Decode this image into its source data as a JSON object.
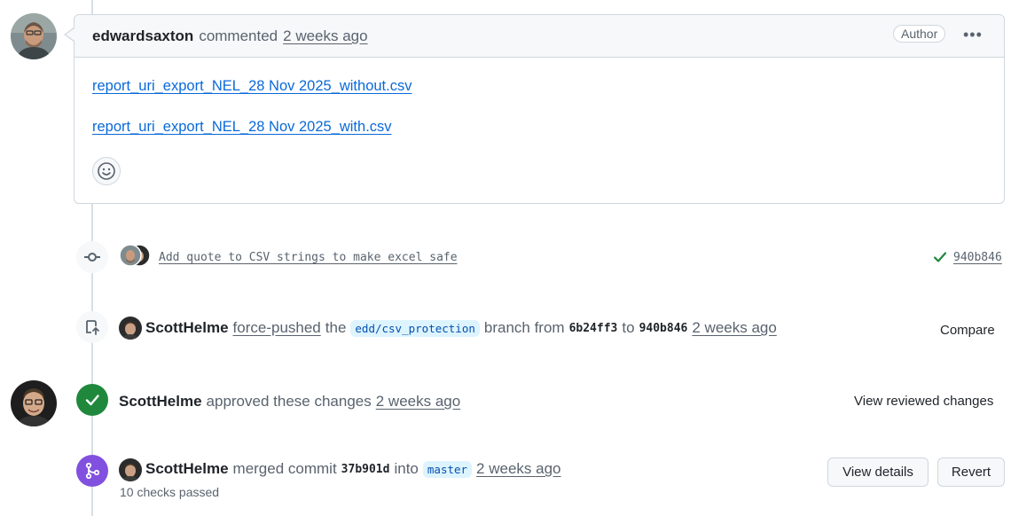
{
  "comment": {
    "author": "edwardsaxton",
    "action": "commented",
    "time": "2 weeks ago",
    "badge": "Author",
    "menu_glyph": "•••",
    "links": [
      "report_uri_export_NEL_28 Nov 2025_without.csv",
      "report_uri_export_NEL_28 Nov 2025_with.csv"
    ]
  },
  "commit_event": {
    "message": "Add quote to CSV strings to make excel safe",
    "sha": "940b846"
  },
  "force_push_event": {
    "actor": "ScottHelme",
    "action": "force-pushed",
    "the": "the",
    "branch": "edd/csv_protection",
    "branch_word": "branch from",
    "from_sha": "6b24ff3",
    "to_word": "to",
    "to_sha": "940b846",
    "time": "2 weeks ago",
    "compare_label": "Compare"
  },
  "approve_event": {
    "actor": "ScottHelme",
    "action": "approved these changes",
    "time": "2 weeks ago",
    "view_label": "View reviewed changes"
  },
  "merge_event": {
    "actor": "ScottHelme",
    "action": "merged commit",
    "sha": "37b901d",
    "into": "into",
    "branch": "master",
    "time": "2 weeks ago",
    "checks": "10 checks passed",
    "details_label": "View details",
    "revert_label": "Revert"
  },
  "colors": {
    "success": "#1f883d",
    "merged": "#8250df",
    "link": "#0969da"
  }
}
